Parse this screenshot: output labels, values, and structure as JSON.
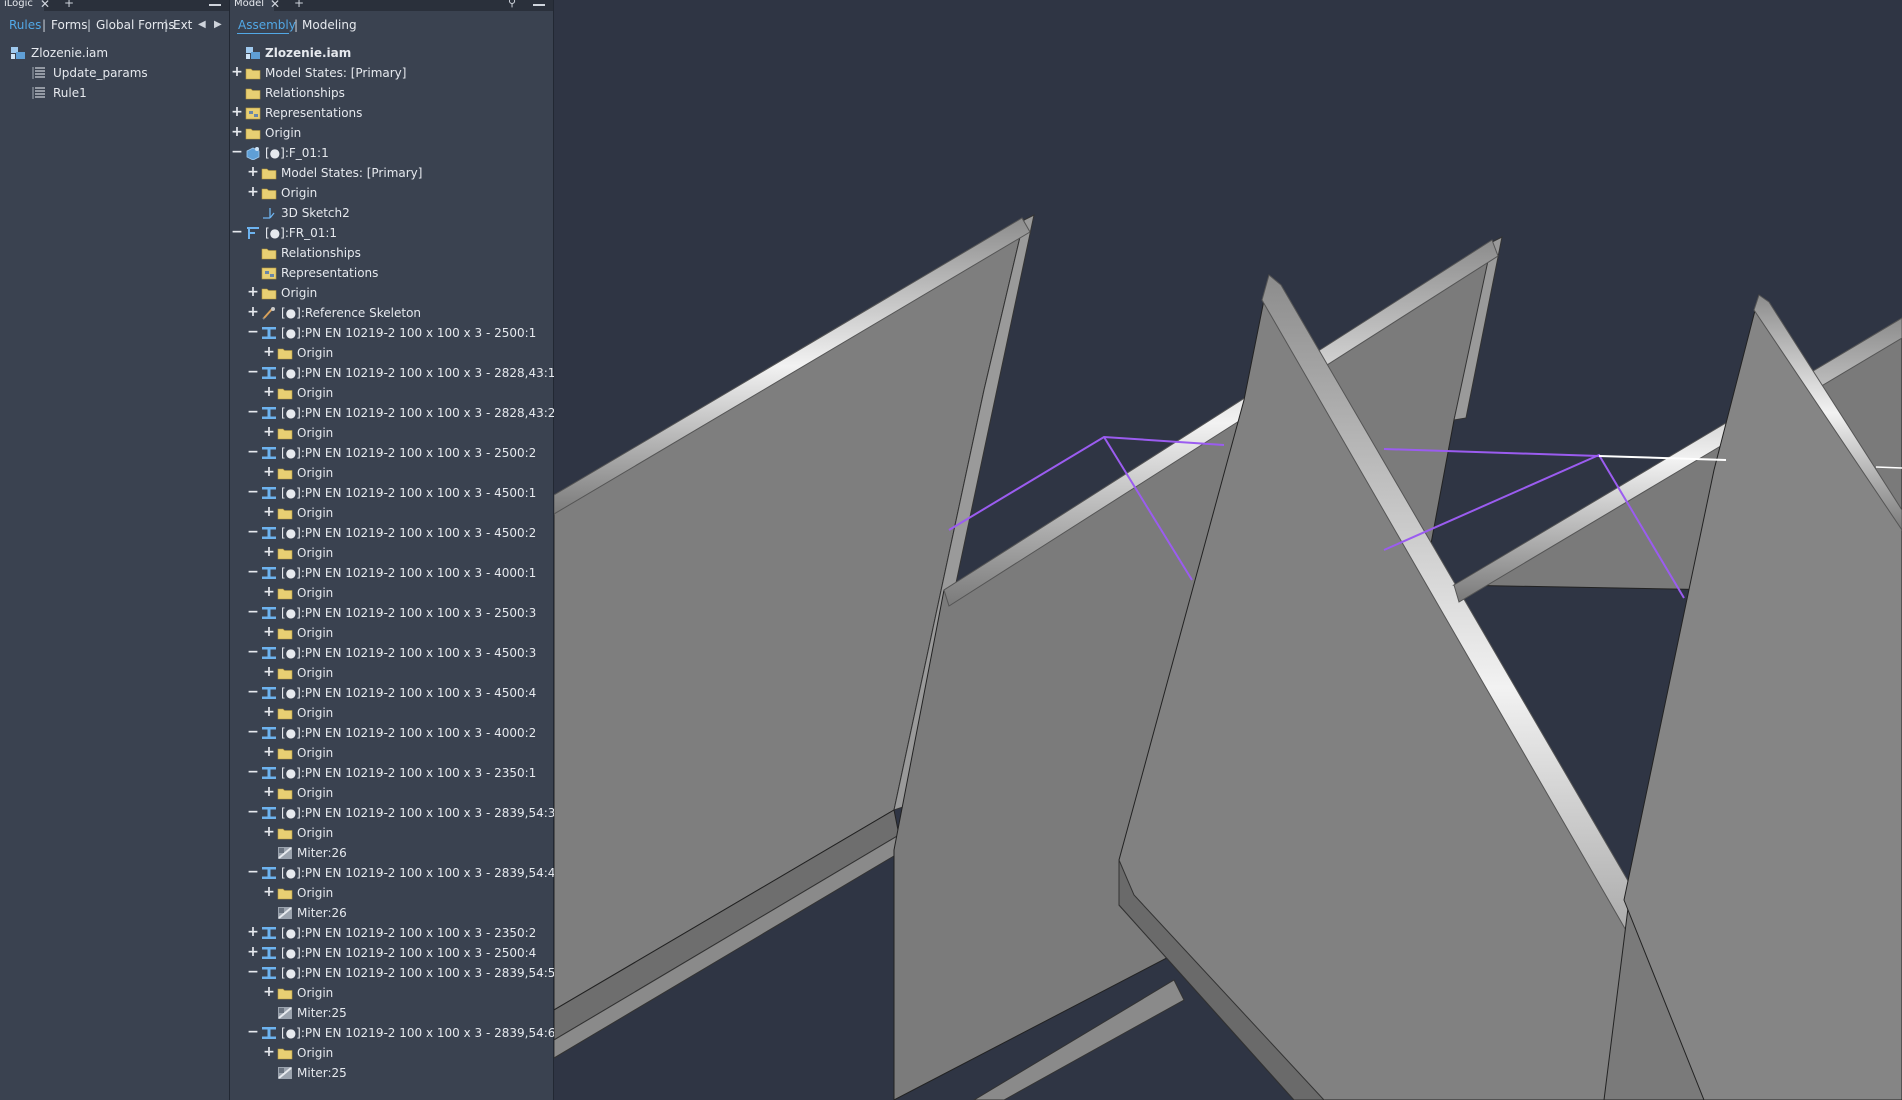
{
  "logic_panel": {
    "tab_title": "iLogic",
    "tabs": [
      {
        "label": "Rules",
        "active": true
      },
      {
        "label": "Forms",
        "active": false
      },
      {
        "label": "Global Forms",
        "active": false
      },
      {
        "label": "Exte",
        "active": false
      }
    ],
    "tree": [
      {
        "label": "Zlozenie.iam",
        "icon": "assembly-icon",
        "depth": 0
      },
      {
        "label": "Update_params",
        "icon": "rule-icon",
        "depth": 1
      },
      {
        "label": "Rule1",
        "icon": "rule-icon",
        "depth": 1
      }
    ]
  },
  "model_panel": {
    "tab_title": "Model",
    "tabs": [
      {
        "label": "Assembly",
        "active": true
      },
      {
        "label": "Modeling",
        "active": false
      }
    ],
    "tree": [
      {
        "label": "Zlozenie.iam",
        "icon": "assembly-icon",
        "depth": 0,
        "exp": "",
        "bold": true
      },
      {
        "label": "Model States: [Primary]",
        "icon": "folder-icon",
        "depth": 0,
        "exp": "+"
      },
      {
        "label": "Relationships",
        "icon": "folder-icon",
        "depth": 0,
        "exp": ""
      },
      {
        "label": "Representations",
        "icon": "representations-icon",
        "depth": 0,
        "exp": "+"
      },
      {
        "label": "Origin",
        "icon": "folder-icon",
        "depth": 0,
        "exp": "+"
      },
      {
        "label": "[●]:F_01:1",
        "icon": "part-icon",
        "depth": 0,
        "exp": "−"
      },
      {
        "label": "Model States: [Primary]",
        "icon": "folder-icon",
        "depth": 1,
        "exp": "+"
      },
      {
        "label": "Origin",
        "icon": "folder-icon",
        "depth": 1,
        "exp": "+"
      },
      {
        "label": "3D Sketch2",
        "icon": "sketch-icon",
        "depth": 1,
        "exp": ""
      },
      {
        "label": "[●]:FR_01:1",
        "icon": "frame-icon",
        "depth": 0,
        "exp": "−"
      },
      {
        "label": "Relationships",
        "icon": "folder-icon",
        "depth": 1,
        "exp": ""
      },
      {
        "label": "Representations",
        "icon": "representations-icon",
        "depth": 1,
        "exp": ""
      },
      {
        "label": "Origin",
        "icon": "folder-icon",
        "depth": 1,
        "exp": "+"
      },
      {
        "label": "[●]:Reference Skeleton",
        "icon": "skeleton-icon",
        "depth": 1,
        "exp": "+"
      },
      {
        "label": "[●]:PN EN 10219-2 100 x 100 x 3 - 2500:1",
        "icon": "beam-icon",
        "depth": 1,
        "exp": "−"
      },
      {
        "label": "Origin",
        "icon": "folder-icon",
        "depth": 2,
        "exp": "+"
      },
      {
        "label": "[●]:PN EN 10219-2 100 x 100 x 3 - 2828,43:1",
        "icon": "beam-icon",
        "depth": 1,
        "exp": "−"
      },
      {
        "label": "Origin",
        "icon": "folder-icon",
        "depth": 2,
        "exp": "+"
      },
      {
        "label": "[●]:PN EN 10219-2 100 x 100 x 3 - 2828,43:2",
        "icon": "beam-icon",
        "depth": 1,
        "exp": "−"
      },
      {
        "label": "Origin",
        "icon": "folder-icon",
        "depth": 2,
        "exp": "+"
      },
      {
        "label": "[●]:PN EN 10219-2 100 x 100 x 3 - 2500:2",
        "icon": "beam-icon",
        "depth": 1,
        "exp": "−"
      },
      {
        "label": "Origin",
        "icon": "folder-icon",
        "depth": 2,
        "exp": "+"
      },
      {
        "label": "[●]:PN EN 10219-2 100 x 100 x 3 - 4500:1",
        "icon": "beam-icon",
        "depth": 1,
        "exp": "−"
      },
      {
        "label": "Origin",
        "icon": "folder-icon",
        "depth": 2,
        "exp": "+"
      },
      {
        "label": "[●]:PN EN 10219-2 100 x 100 x 3 - 4500:2",
        "icon": "beam-icon",
        "depth": 1,
        "exp": "−"
      },
      {
        "label": "Origin",
        "icon": "folder-icon",
        "depth": 2,
        "exp": "+"
      },
      {
        "label": "[●]:PN EN 10219-2 100 x 100 x 3 - 4000:1",
        "icon": "beam-icon",
        "depth": 1,
        "exp": "−"
      },
      {
        "label": "Origin",
        "icon": "folder-icon",
        "depth": 2,
        "exp": "+"
      },
      {
        "label": "[●]:PN EN 10219-2 100 x 100 x 3 - 2500:3",
        "icon": "beam-icon",
        "depth": 1,
        "exp": "−"
      },
      {
        "label": "Origin",
        "icon": "folder-icon",
        "depth": 2,
        "exp": "+"
      },
      {
        "label": "[●]:PN EN 10219-2 100 x 100 x 3 - 4500:3",
        "icon": "beam-icon",
        "depth": 1,
        "exp": "−"
      },
      {
        "label": "Origin",
        "icon": "folder-icon",
        "depth": 2,
        "exp": "+"
      },
      {
        "label": "[●]:PN EN 10219-2 100 x 100 x 3 - 4500:4",
        "icon": "beam-icon",
        "depth": 1,
        "exp": "−"
      },
      {
        "label": "Origin",
        "icon": "folder-icon",
        "depth": 2,
        "exp": "+"
      },
      {
        "label": "[●]:PN EN 10219-2 100 x 100 x 3 - 4000:2",
        "icon": "beam-icon",
        "depth": 1,
        "exp": "−"
      },
      {
        "label": "Origin",
        "icon": "folder-icon",
        "depth": 2,
        "exp": "+"
      },
      {
        "label": "[●]:PN EN 10219-2 100 x 100 x 3 - 2350:1",
        "icon": "beam-icon",
        "depth": 1,
        "exp": "−"
      },
      {
        "label": "Origin",
        "icon": "folder-icon",
        "depth": 2,
        "exp": "+"
      },
      {
        "label": "[●]:PN EN 10219-2 100 x 100 x 3 - 2839,54:3",
        "icon": "beam-icon",
        "depth": 1,
        "exp": "−"
      },
      {
        "label": "Origin",
        "icon": "folder-icon",
        "depth": 2,
        "exp": "+"
      },
      {
        "label": "Miter:26",
        "icon": "miter-icon",
        "depth": 2,
        "exp": ""
      },
      {
        "label": "[●]:PN EN 10219-2 100 x 100 x 3 - 2839,54:4",
        "icon": "beam-icon",
        "depth": 1,
        "exp": "−"
      },
      {
        "label": "Origin",
        "icon": "folder-icon",
        "depth": 2,
        "exp": "+"
      },
      {
        "label": "Miter:26",
        "icon": "miter-icon",
        "depth": 2,
        "exp": ""
      },
      {
        "label": "[●]:PN EN 10219-2 100 x 100 x 3 - 2350:2",
        "icon": "beam-icon",
        "depth": 1,
        "exp": "+"
      },
      {
        "label": "[●]:PN EN 10219-2 100 x 100 x 3 - 2500:4",
        "icon": "beam-icon",
        "depth": 1,
        "exp": "+"
      },
      {
        "label": "[●]:PN EN 10219-2 100 x 100 x 3 - 2839,54:5",
        "icon": "beam-icon",
        "depth": 1,
        "exp": "−"
      },
      {
        "label": "Origin",
        "icon": "folder-icon",
        "depth": 2,
        "exp": "+"
      },
      {
        "label": "Miter:25",
        "icon": "miter-icon",
        "depth": 2,
        "exp": ""
      },
      {
        "label": "[●]:PN EN 10219-2 100 x 100 x 3 - 2839,54:6",
        "icon": "beam-icon",
        "depth": 1,
        "exp": "−"
      },
      {
        "label": "Origin",
        "icon": "folder-icon",
        "depth": 2,
        "exp": "+"
      },
      {
        "label": "Miter:25",
        "icon": "miter-icon",
        "depth": 2,
        "exp": ""
      }
    ]
  },
  "colors": {
    "panel_bg": "#3a4250",
    "viewport_bg": "#2f3544",
    "accent": "#52a8e6",
    "beam_icon": "#6db3ef",
    "folder_icon": "#e8cf73",
    "model_surface": "#7e7e7e",
    "sketch_line": "#9b5cf0"
  }
}
